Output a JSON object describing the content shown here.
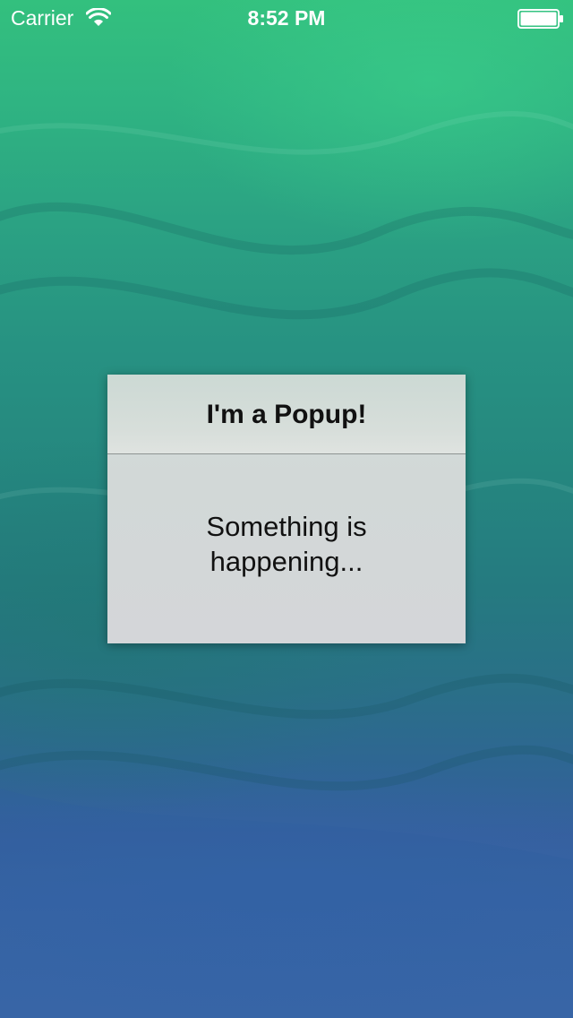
{
  "status_bar": {
    "carrier": "Carrier",
    "time": "8:52 PM",
    "wifi_icon": "wifi-icon",
    "battery_icon": "battery-icon"
  },
  "popup": {
    "title": "I'm a Popup!",
    "message_line1": "Something is",
    "message_line2": "happening..."
  },
  "colors": {
    "background_top": "#33c07e",
    "background_bottom": "#3d68aa",
    "popup_background": "#d3d8d8",
    "text": "#111111"
  }
}
